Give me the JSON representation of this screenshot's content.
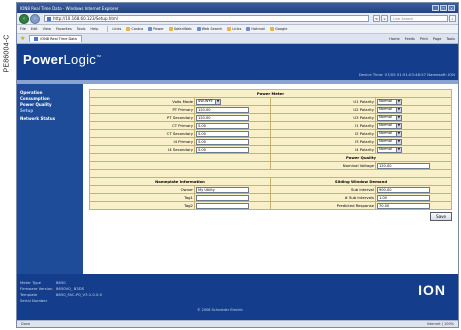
{
  "figure_label": "PE86004-C",
  "window": {
    "title": "ION8 Real Time Data - Windows Internet Explorer"
  },
  "address_bar": {
    "url": "http://10.168.60.123/Setup.html",
    "search_placeholder": "Live Search"
  },
  "menu": {
    "items": [
      "File",
      "Edit",
      "View",
      "Favorites",
      "Tools",
      "Help"
    ],
    "links": [
      "Links",
      "Costco",
      "Power",
      "SafariWeb",
      "Web Search",
      "Links",
      "Hotmail",
      "Google"
    ]
  },
  "tab": {
    "label": "ION8 Real Time Data",
    "tools": [
      "Home",
      "Feeds",
      "Print",
      "Page",
      "Tools"
    ]
  },
  "brand": {
    "name_bold": "Power",
    "name_light": "Logic"
  },
  "device_info": "Device Time: 07/05 01:51:03:48:57 Namesoft: ION",
  "nav": {
    "items": [
      "Operation",
      "Consumption",
      "Power Quality",
      "Setup",
      "Network Status"
    ],
    "active_index": 3
  },
  "power_meter": {
    "section_title": "Power Meter",
    "left": [
      {
        "label": "Volts Mode",
        "value": "4W-WYE",
        "type": "select"
      },
      {
        "label": "PT Primary",
        "value": "120.00",
        "type": "input"
      },
      {
        "label": "PT Secondary",
        "value": "120.00",
        "type": "input"
      },
      {
        "label": "CT Primary",
        "value": "5.00",
        "type": "input"
      },
      {
        "label": "CT Secondary",
        "value": "5.00",
        "type": "input"
      },
      {
        "label": "I4 Primary",
        "value": "5.00",
        "type": "input"
      },
      {
        "label": "I4 Secondary",
        "value": "5.00",
        "type": "input"
      }
    ],
    "right": [
      {
        "label": "U1 Polarity",
        "value": "Normal",
        "type": "select"
      },
      {
        "label": "U2 Polarity",
        "value": "Normal",
        "type": "select"
      },
      {
        "label": "U3 Polarity",
        "value": "Normal",
        "type": "select"
      },
      {
        "label": "I1 Polarity",
        "value": "Normal",
        "type": "select"
      },
      {
        "label": "I2 Polarity",
        "value": "Normal",
        "type": "select"
      },
      {
        "label": "I3 Polarity",
        "value": "Normal",
        "type": "select"
      },
      {
        "label": "I4 Polarity",
        "value": "Normal",
        "type": "select"
      }
    ]
  },
  "power_quality": {
    "section_title": "Power Quality",
    "nominal_voltage_label": "Nominal Voltage",
    "nominal_voltage_value": "120.00"
  },
  "nameplate": {
    "section_title": "Nameplate Information",
    "rows": [
      {
        "label": "Owner",
        "value": "My Utility"
      },
      {
        "label": "Tag1",
        "value": ""
      },
      {
        "label": "Tag2",
        "value": ""
      }
    ]
  },
  "demand": {
    "section_title": "Sliding Window Demand",
    "rows": [
      {
        "label": "Sub Interval",
        "value": "900.00"
      },
      {
        "label": "# Sub Intervals",
        "value": "1.00"
      },
      {
        "label": "Predicted Response",
        "value": "70.00"
      }
    ]
  },
  "save_label": "Save",
  "footer": {
    "rows": [
      {
        "key": "Meter Type",
        "value": "8650"
      },
      {
        "key": "Firmware Version",
        "value": "8650V0_ B3DS"
      },
      {
        "key": "Template",
        "value": "8650_FAC-P0_V3.1.0.0.0"
      },
      {
        "key": "Serial Number",
        "value": ""
      }
    ],
    "copyright": "© 2008 Schneider Electric",
    "logo": "ION"
  },
  "statusbar": {
    "left": "Done",
    "right": "Internet | 100%"
  }
}
